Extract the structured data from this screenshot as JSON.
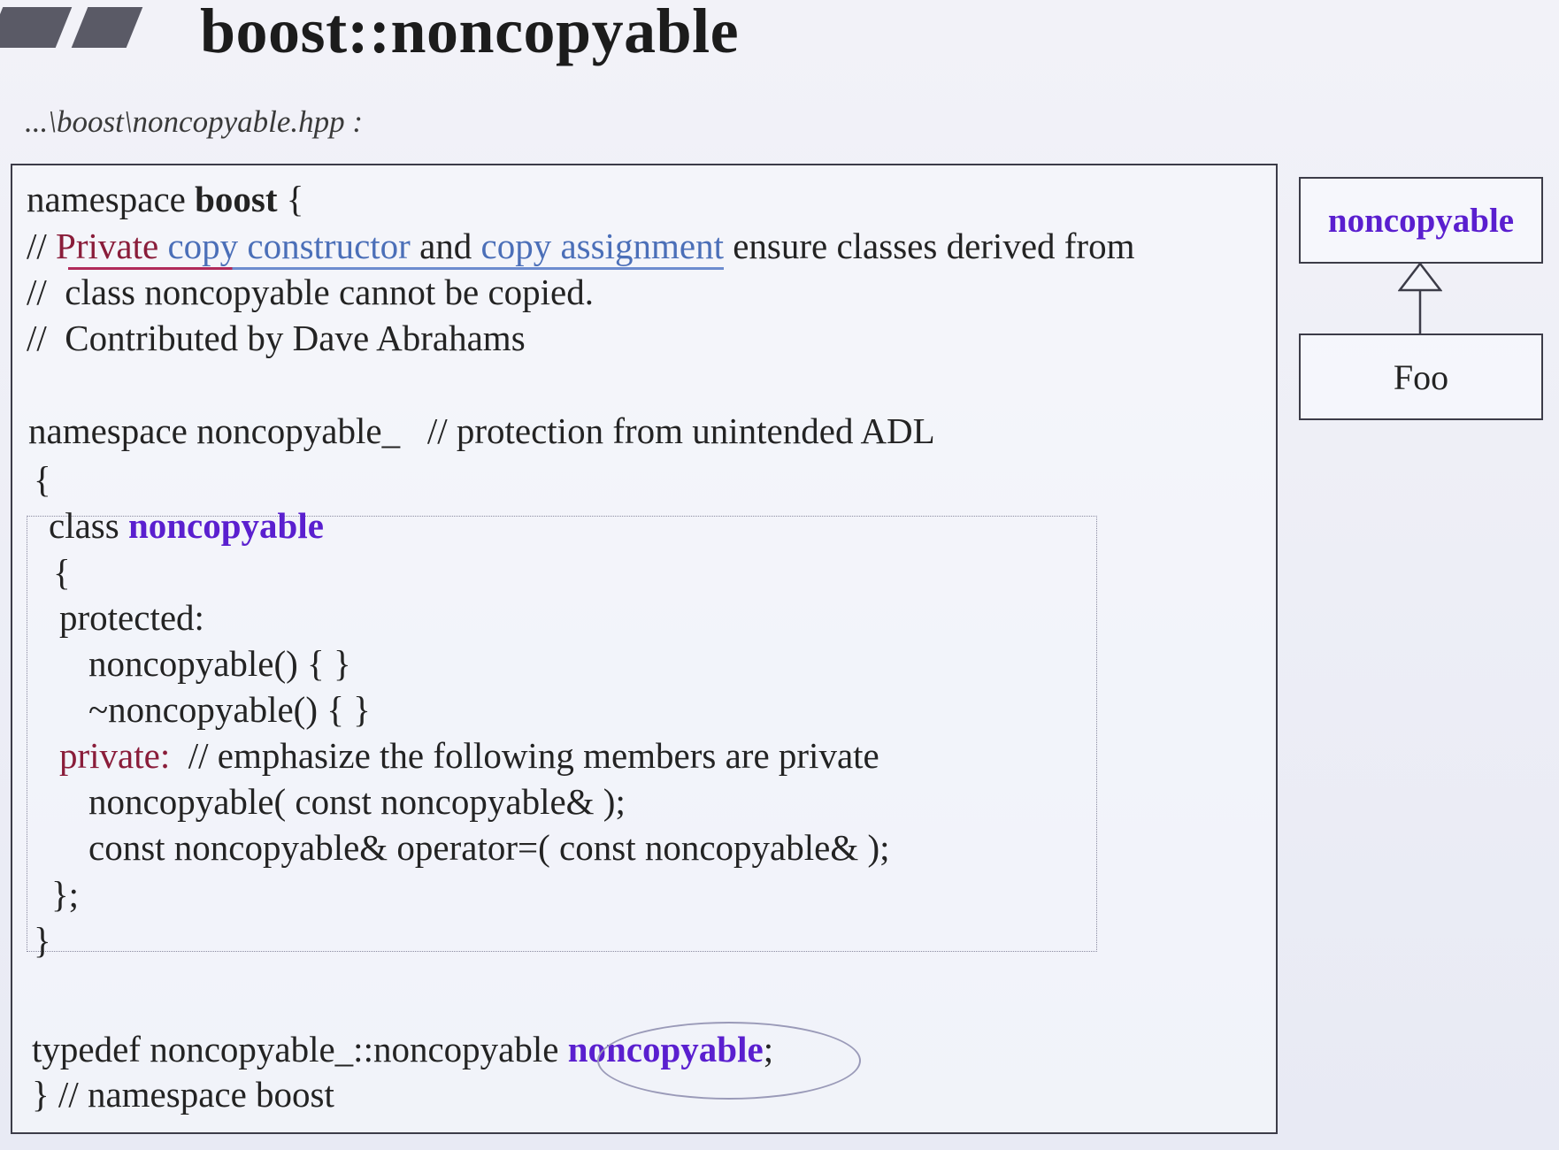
{
  "slide": {
    "title": "boost::noncopyable",
    "file_path": "...\\boost\\noncopyable.hpp :"
  },
  "code": {
    "l1_kw": "namespace ",
    "l1_name": "boost",
    "l1_brace": " {",
    "l2_slashes": "// ",
    "l2_private": "Private",
    "l2_copy_ctor": "copy constructor",
    "l2_and": " and ",
    "l2_copy_assign": "copy assignment",
    "l2_rest": " ensure classes derived from",
    "l3": "//  class noncopyable cannot be copied.",
    "l4": "//  Contributed by Dave Abrahams",
    "l5": "namespace noncopyable_   // protection from unintended ADL",
    "l6": "{",
    "l7_kw": "class ",
    "l7_name": "noncopyable",
    "l8": "{",
    "l9": "protected:",
    "l10": "noncopyable() { }",
    "l11": "~noncopyable() { }",
    "l12_kw": "private:",
    "l12_comment": "  // emphasize the following members are private",
    "l13": "noncopyable( const noncopyable& );",
    "l14": "const noncopyable& operator=( const noncopyable& );",
    "l15": "};",
    "l16": "}",
    "l17_pre": "typedef noncopyable_::noncopyable ",
    "l17_name": "noncopyable",
    "l17_semi": ";",
    "l18": "} // namespace boost"
  },
  "uml": {
    "base_class": "noncopyable",
    "derived_class": "Foo"
  },
  "colors": {
    "keyword_purple": "#5a1fcf",
    "private_red": "#8a1d3a",
    "copy_blue": "#4b6fb8"
  }
}
